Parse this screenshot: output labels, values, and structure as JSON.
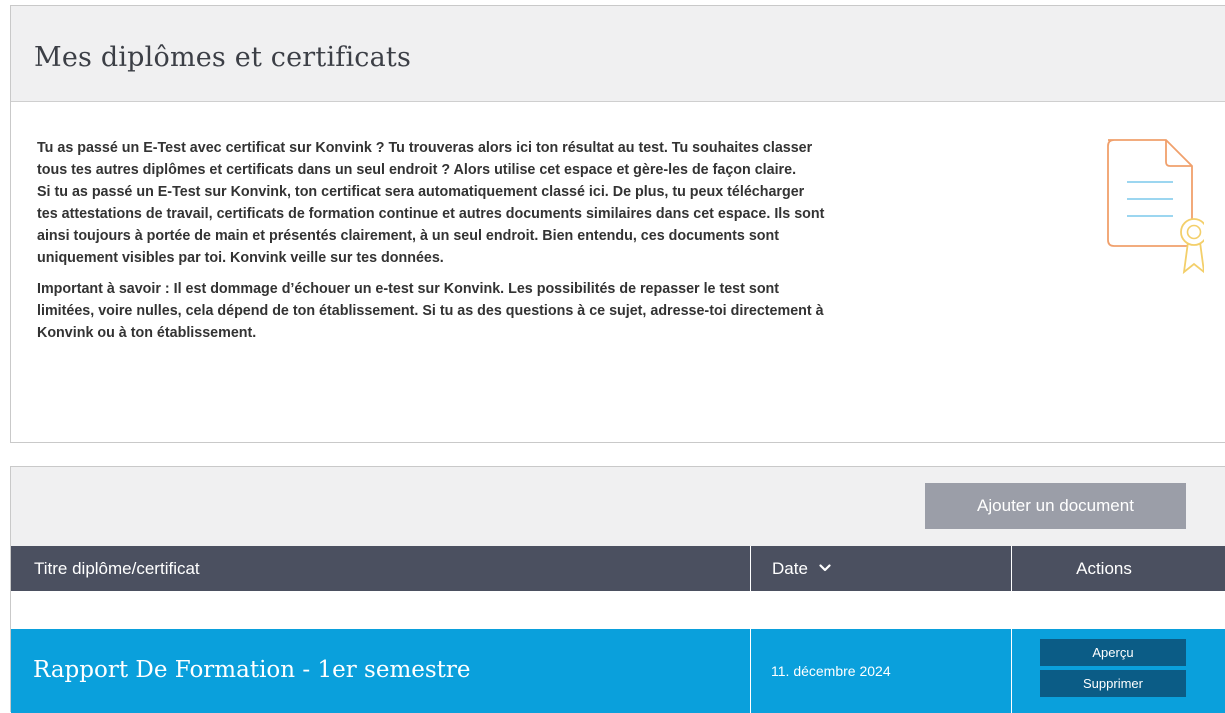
{
  "page": {
    "title": "Mes diplômes et certificats",
    "intro_paragraphs": [
      "Tu as passé un E-Test avec certificat sur Konvink ? Tu trouveras alors ici ton résultat au test. Tu souhaites classer tous tes autres diplômes et certificats dans un seul endroit ? Alors utilise cet espace et gère-les de façon claire.",
      "Si tu as passé un E-Test sur Konvink, ton certificat sera automatiquement classé ici. De plus, tu peux télécharger tes attestations de travail, certificats de formation continue et autres documents similaires dans cet espace. Ils sont ainsi toujours à portée de main et présentés clairement, à un seul endroit. Bien entendu, ces documents sont uniquement visibles par toi. Konvink veille sur tes données.",
      "Important à savoir : Il est dommage d’échouer un e-test sur Konvink. Les possibilités de repasser le test sont limitées, voire nulles, cela dépend de ton établissement. Si tu as des questions à ce sujet, adresse-toi directement à Konvink ou à ton établissement."
    ],
    "illustration_icon": "certificate-document-icon"
  },
  "toolbar": {
    "add_label": "Ajouter un document"
  },
  "table": {
    "columns": {
      "title": "Titre diplôme/certificat",
      "date": "Date",
      "actions": "Actions"
    },
    "sort_icon": "chevron-down-icon",
    "rows": [
      {
        "title": "Rapport De Formation - 1er semestre",
        "date": "11. décembre 2024",
        "preview_label": "Aperçu",
        "delete_label": "Supprimer"
      }
    ]
  },
  "colors": {
    "header_bg": "#f0f0f1",
    "table_head_bg": "#4b5060",
    "row_bg": "#0aa0dc",
    "action_button_bg": "#0b5c86",
    "add_button_bg": "#9b9ea8",
    "icon_orange": "#f0a06c",
    "icon_blue": "#8ed0ee",
    "icon_yellow": "#f3cf6a"
  }
}
